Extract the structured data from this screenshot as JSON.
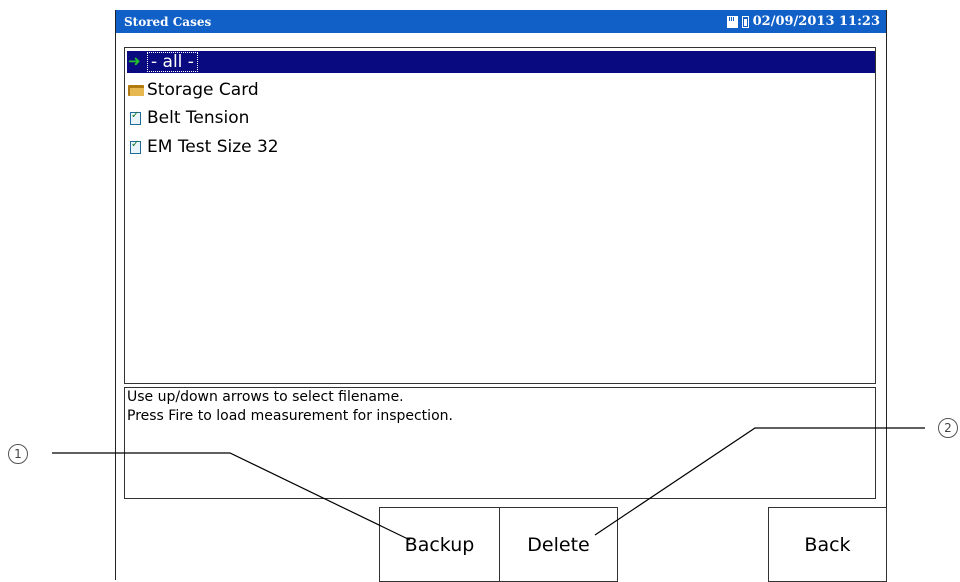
{
  "titlebar": {
    "title": "Stored Cases",
    "datetime": "02/09/2013 11:23",
    "icons": [
      "sd-card-icon",
      "battery-icon"
    ]
  },
  "list": {
    "items": [
      {
        "label": "- all -",
        "icon": "green-arrow-icon",
        "selected": true
      },
      {
        "label": "Storage Card",
        "icon": "folder-icon",
        "selected": false
      },
      {
        "label": "Belt Tension",
        "icon": "document-check-icon",
        "selected": false
      },
      {
        "label": "EM Test Size 32",
        "icon": "document-check-icon",
        "selected": false
      }
    ]
  },
  "hint": {
    "line1": "Use up/down arrows to select filename.",
    "line2": "Press Fire to load measurement for inspection."
  },
  "buttons": {
    "backup": "Backup",
    "delete": "Delete",
    "back": "Back"
  },
  "callouts": {
    "one": "1",
    "two": "2"
  },
  "colors": {
    "titlebar": "#1060c8",
    "selection": "#0a0a80",
    "arrow": "#22c02a"
  }
}
